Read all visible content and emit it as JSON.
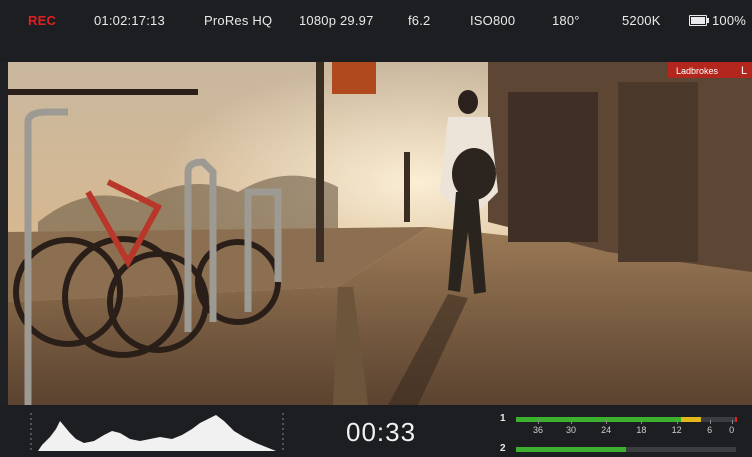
{
  "status_bar": {
    "record": "REC",
    "timecode": "01:02:17:13",
    "codec": "ProRes HQ",
    "format": "1080p 29.97",
    "iris": "f6.2",
    "iso": "ISO800",
    "shutter": "180°",
    "white_balance": "5200K",
    "battery": "100%",
    "battery_level": 1.0,
    "colors": {
      "rec": "#e02020",
      "text": "#e9e9e9"
    }
  },
  "viewfinder": {
    "signs": [
      "Ladbrokes",
      "L"
    ],
    "icon": "video-frame"
  },
  "bottom_bar": {
    "histogram_icon": "histogram",
    "duration": "00:33",
    "audio": {
      "channels": [
        {
          "label": "1",
          "level": 0.84,
          "peak": 0.88
        },
        {
          "label": "2",
          "level": 0.5,
          "peak": 0.5
        }
      ],
      "scale": [
        "36",
        "30",
        "24",
        "18",
        "12",
        "6",
        "0"
      ],
      "colors": {
        "normal": "#3db12f",
        "warn": "#e3b81a",
        "peak": "#e02020"
      }
    }
  }
}
